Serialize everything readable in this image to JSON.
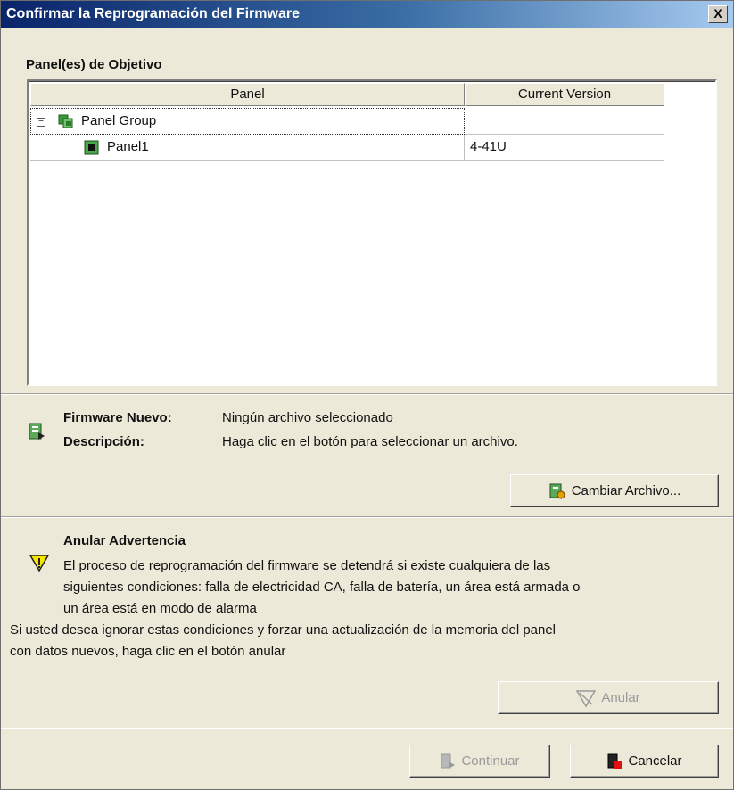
{
  "window": {
    "title": "Confirmar la Reprogramación del Firmware",
    "close_label": "X"
  },
  "targets": {
    "section_title": "Panel(es) de Objetivo",
    "columns": [
      "Panel",
      "Current Version"
    ],
    "rows": [
      {
        "name": "Panel Group",
        "version": ""
      },
      {
        "name": "Panel1",
        "version": "4-41U"
      }
    ]
  },
  "firmware": {
    "new_label": "Firmware Nuevo:",
    "new_value": "Ningún archivo seleccionado",
    "desc_label": "Descripción:",
    "desc_value": "Haga clic en el botón para seleccionar un archivo.",
    "change_button": "Cambiar Archivo..."
  },
  "warning": {
    "title": "Anular Advertencia",
    "line1": "El proceso de reprogramación del firmware se detendrá si existe cualquiera de las",
    "line2": "siguientes condiciones: falla de electricidad CA, falla de batería, un área está armada o",
    "line3": "un área está en modo de alarma",
    "line4": "Si usted desea ignorar estas condiciones y forzar una actualización de la memoria del panel",
    "line5": "con datos nuevos, haga clic en el botón anular",
    "override_button": "Anular"
  },
  "footer": {
    "continue_button": "Continuar",
    "cancel_button": "Cancelar"
  },
  "icons": {
    "panel_group": "panel-group-icon",
    "panel": "panel-chip-icon",
    "firmware": "firmware-file-icon",
    "warning": "warning-triangle-icon"
  }
}
